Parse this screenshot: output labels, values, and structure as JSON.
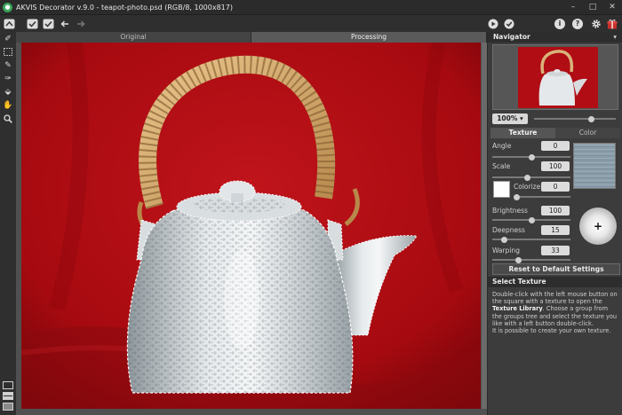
{
  "window": {
    "title": "AKVIS Decorator v.9.0 - teapot-photo.psd (RGB/8, 1000x817)",
    "controls": {
      "minimize": "–",
      "maximize": "□",
      "close": "✕"
    }
  },
  "toolbar": {
    "left_icons": [
      "home-icon",
      "apply-check-icon",
      "save-check-icon",
      "undo-arrow-icon",
      "redo-arrow-icon"
    ],
    "right_icons": [
      "run-play-icon",
      "apply-check-icon",
      "info-icon",
      "help-icon",
      "settings-gear-icon",
      "gift-icon"
    ]
  },
  "tools": [
    "eraser-icon",
    "selection-rect-icon",
    "pencil-icon",
    "brush-icon",
    "paint-bucket-icon",
    "hand-icon",
    "zoom-icon"
  ],
  "tabs": {
    "original": "Original",
    "processing": "Processing"
  },
  "navigator": {
    "title": "Navigator",
    "zoom": "100%",
    "zoom_slider": 0.7
  },
  "settings": {
    "tab_texture": "Texture",
    "tab_color": "Color",
    "angle_label": "Angle",
    "angle_value": "0",
    "angle_slider": 0.5,
    "scale_label": "Scale",
    "scale_value": "100",
    "scale_slider": 0.45,
    "colorize_label": "Colorize",
    "colorize_value": "0",
    "colorize_color": "#ffffff",
    "brightness_label": "Brightness",
    "brightness_value": "100",
    "brightness_slider": 0.5,
    "deepness_label": "Deepness",
    "deepness_value": "15",
    "deepness_slider": 0.15,
    "warping_label": "Warping",
    "warping_value": "33",
    "warping_slider": 0.33,
    "reset_button": "Reset to Default Settings"
  },
  "help": {
    "title": "Select Texture",
    "text_1": "Double-click with the left mouse button on the square with a texture to open the ",
    "text_bold": "Texture Library",
    "text_2": ". Choose a group from the groups tree and select the texture you like with a left button double-click.",
    "text_3": "It is possible to create your own texture."
  },
  "colors": {
    "background": "#ad0b12",
    "panel": "#3c3c3c",
    "toolbar": "#2f2f2f"
  }
}
